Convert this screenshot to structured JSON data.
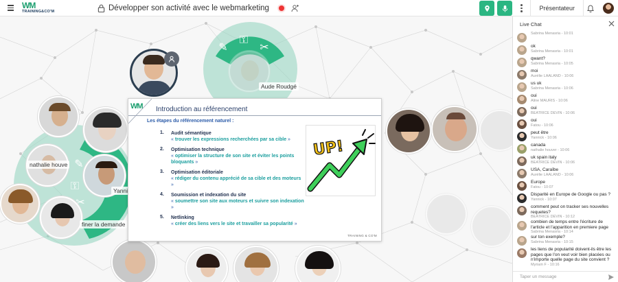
{
  "header": {
    "logo_mark": "WM",
    "logo_text": "TRAINING&CO'M",
    "session_title": "Développer son activité avec le webmarketing",
    "presenter_label": "Présentateur"
  },
  "stage": {
    "names": {
      "aude": "Aude Roudgé",
      "nathalie": "nathalie houve",
      "yannick": "Yanni",
      "demande": "finer la demande"
    }
  },
  "slide": {
    "logo": "WM",
    "title": "Introduction au référencement",
    "subtitle": "Les étapes du référencement naturel :",
    "steps": [
      {
        "num": "1.",
        "head": "Audit sémantique",
        "desc_pre": "« ",
        "desc_bold": "trouver les expressions recherchées par sa cible",
        "desc_post": " »"
      },
      {
        "num": "2.",
        "head": "Optimisation technique",
        "desc_pre": "« ",
        "desc_bold": "optimiser la structure de son site et éviter les points bloquants",
        "desc_post": " »"
      },
      {
        "num": "3.",
        "head": "Optimisation éditoriale",
        "desc_pre": "« ",
        "desc_bold": "rédiger du contenu apprécié de sa cible et des moteurs",
        "desc_post": " »"
      },
      {
        "num": "4.",
        "head": "Soumission et indexation du site",
        "desc_pre": "« ",
        "desc_bold": "soumettre son site aux moteurs et suivre son indexation",
        "desc_post": " »"
      },
      {
        "num": "5.",
        "head": "Netlinking",
        "desc_pre": "« ",
        "desc_bold": "créer des liens vers le site et travailler sa popularité",
        "desc_post": " »"
      }
    ],
    "image_text": "UP!",
    "footer": "TRAINING & CO'M"
  },
  "chat": {
    "title": "Live Chat",
    "input_placeholder": "Taper un message",
    "messages": [
      {
        "text": "",
        "meta": "Sabrina Menasria - 10:01",
        "color": "#b9a58c"
      },
      {
        "text": "ok",
        "meta": "Sabrina Menasria - 10:01",
        "color": "#b9a58c"
      },
      {
        "text": "qwant?",
        "meta": "Sabrina Menasria - 10:05",
        "color": "#b9a58c"
      },
      {
        "text": "moi",
        "meta": "Aurélie LAALAND - 10:06",
        "color": "#8c7a6a"
      },
      {
        "text": "us uk",
        "meta": "Sabrina Menasria - 10:06",
        "color": "#b9a58c"
      },
      {
        "text": "oui",
        "meta": "Aline MAURIS - 10:06",
        "color": "#a58a70"
      },
      {
        "text": "oui",
        "meta": "BEATRICE DEVIN - 10:06",
        "color": "#7d6a5c"
      },
      {
        "text": "oui",
        "meta": "Fatou - 10:06",
        "color": "#6a5040"
      },
      {
        "text": "peut être",
        "meta": "Yannick - 10:06",
        "color": "#2c2c2c"
      },
      {
        "text": "canada",
        "meta": "nathalie houver - 10:06",
        "color": "#9aa06a"
      },
      {
        "text": "uk spain italy",
        "meta": "BEATRICE DEVIN - 10:06",
        "color": "#7d6a5c"
      },
      {
        "text": "USA, Caraïbe",
        "meta": "Aurélie LAALAND - 10:06",
        "color": "#8c7a6a"
      },
      {
        "text": "Europe",
        "meta": "Fatou - 10:07",
        "color": "#6a5040"
      },
      {
        "text": "Disparité en Europe de Google ou pas ?",
        "meta": "Yannick - 10:07",
        "color": "#2c2c2c"
      },
      {
        "text": "comment peut on tracker ses nouvelles requetes?",
        "meta": "BEATRICE DEVIN - 10:12",
        "color": "#7d6a5c"
      },
      {
        "text": "combien de temps entre l'écriture de l'article et l'apparition en premiere page",
        "meta": "Sabrina Menasria - 10:14",
        "color": "#b9a58c"
      },
      {
        "text": "sur ton exemple?",
        "meta": "Sabrina Menasria - 10:15",
        "color": "#b9a58c"
      },
      {
        "text": "les liens de popularité doivent-ils être les pages que l'on veut voir bien placées ou n'importe quelle page du site convient ?",
        "meta": "Myriam F - 10:16",
        "color": "#9a7a66"
      }
    ]
  },
  "colors": {
    "accent": "#2bb682",
    "ring": "#8fd4bd",
    "record": "#ee3333",
    "slide_blue": "#2a5aa8"
  }
}
